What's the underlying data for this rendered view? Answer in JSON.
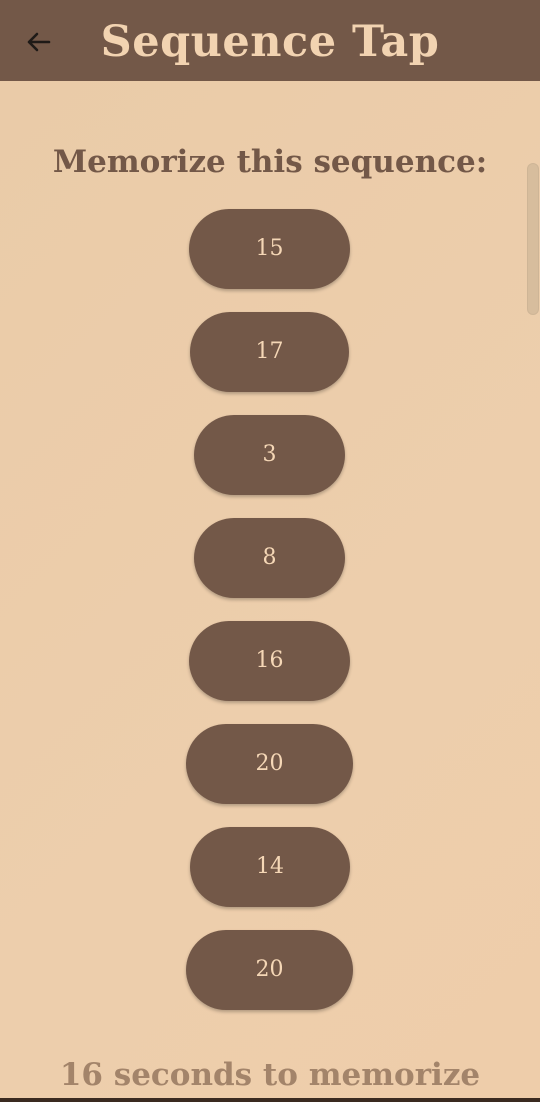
{
  "header": {
    "title": "Sequence Tap"
  },
  "main": {
    "prompt": "Memorize this sequence:",
    "sequence": [
      "15",
      "17",
      "3",
      "8",
      "16",
      "20",
      "14",
      "20"
    ],
    "countdown": "16 seconds to memorize"
  },
  "colors": {
    "background": "#EBCBA8",
    "appbar": "#735848",
    "chip": "#735848",
    "chip_text": "#F5D7B6",
    "footer_text": "#A3846A"
  },
  "icons": {
    "back": "arrow-left-icon"
  }
}
